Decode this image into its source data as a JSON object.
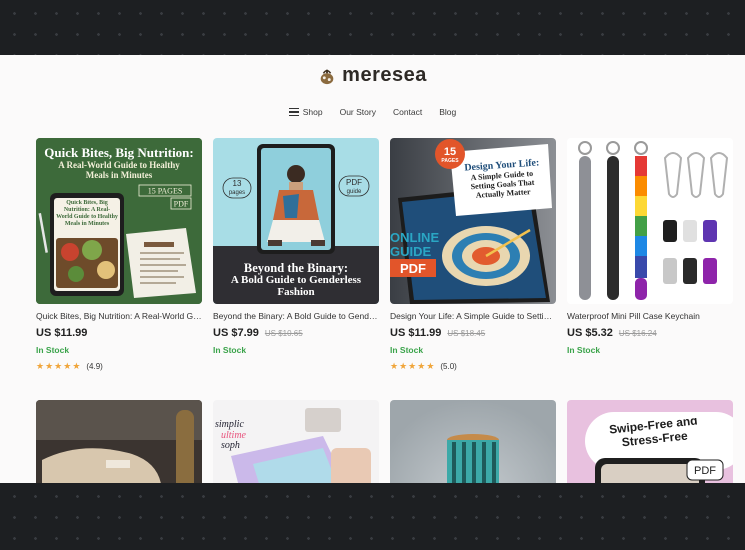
{
  "brand": {
    "name": "meresea"
  },
  "nav": {
    "items": [
      {
        "label": "Shop"
      },
      {
        "label": "Our Story"
      },
      {
        "label": "Contact"
      },
      {
        "label": "Blog"
      }
    ]
  },
  "products": [
    {
      "title": "Quick Bites, Big Nutrition: A Real-World Guide to Healthy Meals in Minutes",
      "price": "US $11.99",
      "old_price": "",
      "stock": "In Stock",
      "rating": "(4.9)",
      "image_text": {
        "heading": "Quick Bites, Big Nutrition:",
        "subheading": "A Real-World Guide to Healthy Meals in Minutes",
        "pages": "15 PAGES",
        "format": "PDF",
        "tablet_text": "Quick Bites, Big Nutrition: A Real-World Guide to Healthy Meals in Minutes"
      }
    },
    {
      "title": "Beyond the Binary: A Bold Guide to Genderless Fashion",
      "price": "US $7.99",
      "old_price": "US $10.65",
      "stock": "In Stock",
      "image_text": {
        "pages_num": "13",
        "pages_word": "pages",
        "format": "PDF",
        "format_word": "guide",
        "heading": "Beyond the Binary:",
        "subheading": "A Bold Guide to Genderless Fashion"
      }
    },
    {
      "title": "Design Your Life: A Simple Guide to Setting Goals That Actually Matter",
      "price": "US $11.99",
      "old_price": "US $18.45",
      "stock": "In Stock",
      "rating": "(5.0)",
      "image_text": {
        "badge_num": "15",
        "badge_word": "PAGES",
        "heading": "Design Your Life:",
        "subheading": "A Simple Guide to Setting Goals That Actually Matter",
        "online": "ONLINE",
        "guide": "GUIDE",
        "format": "PDF"
      }
    },
    {
      "title": "Waterproof Mini Pill Case Keychain",
      "price": "US $5.32",
      "old_price": "US $16.24",
      "stock": "In Stock"
    },
    {
      "title": "",
      "image_text": {
        "label": ""
      }
    },
    {
      "title": "",
      "image_text": {
        "line1": "simplic",
        "line2": "ultime",
        "line3": "soph"
      }
    },
    {
      "title": ""
    },
    {
      "title": "",
      "image_text": {
        "heading": "Swipe-Free and Stress-Free",
        "format": "PDF"
      }
    }
  ],
  "colors": {
    "page_bg": "#1d1f22",
    "site_bg": "#fbfafa",
    "in_stock": "#3aa34a",
    "star": "#f0a53a"
  }
}
